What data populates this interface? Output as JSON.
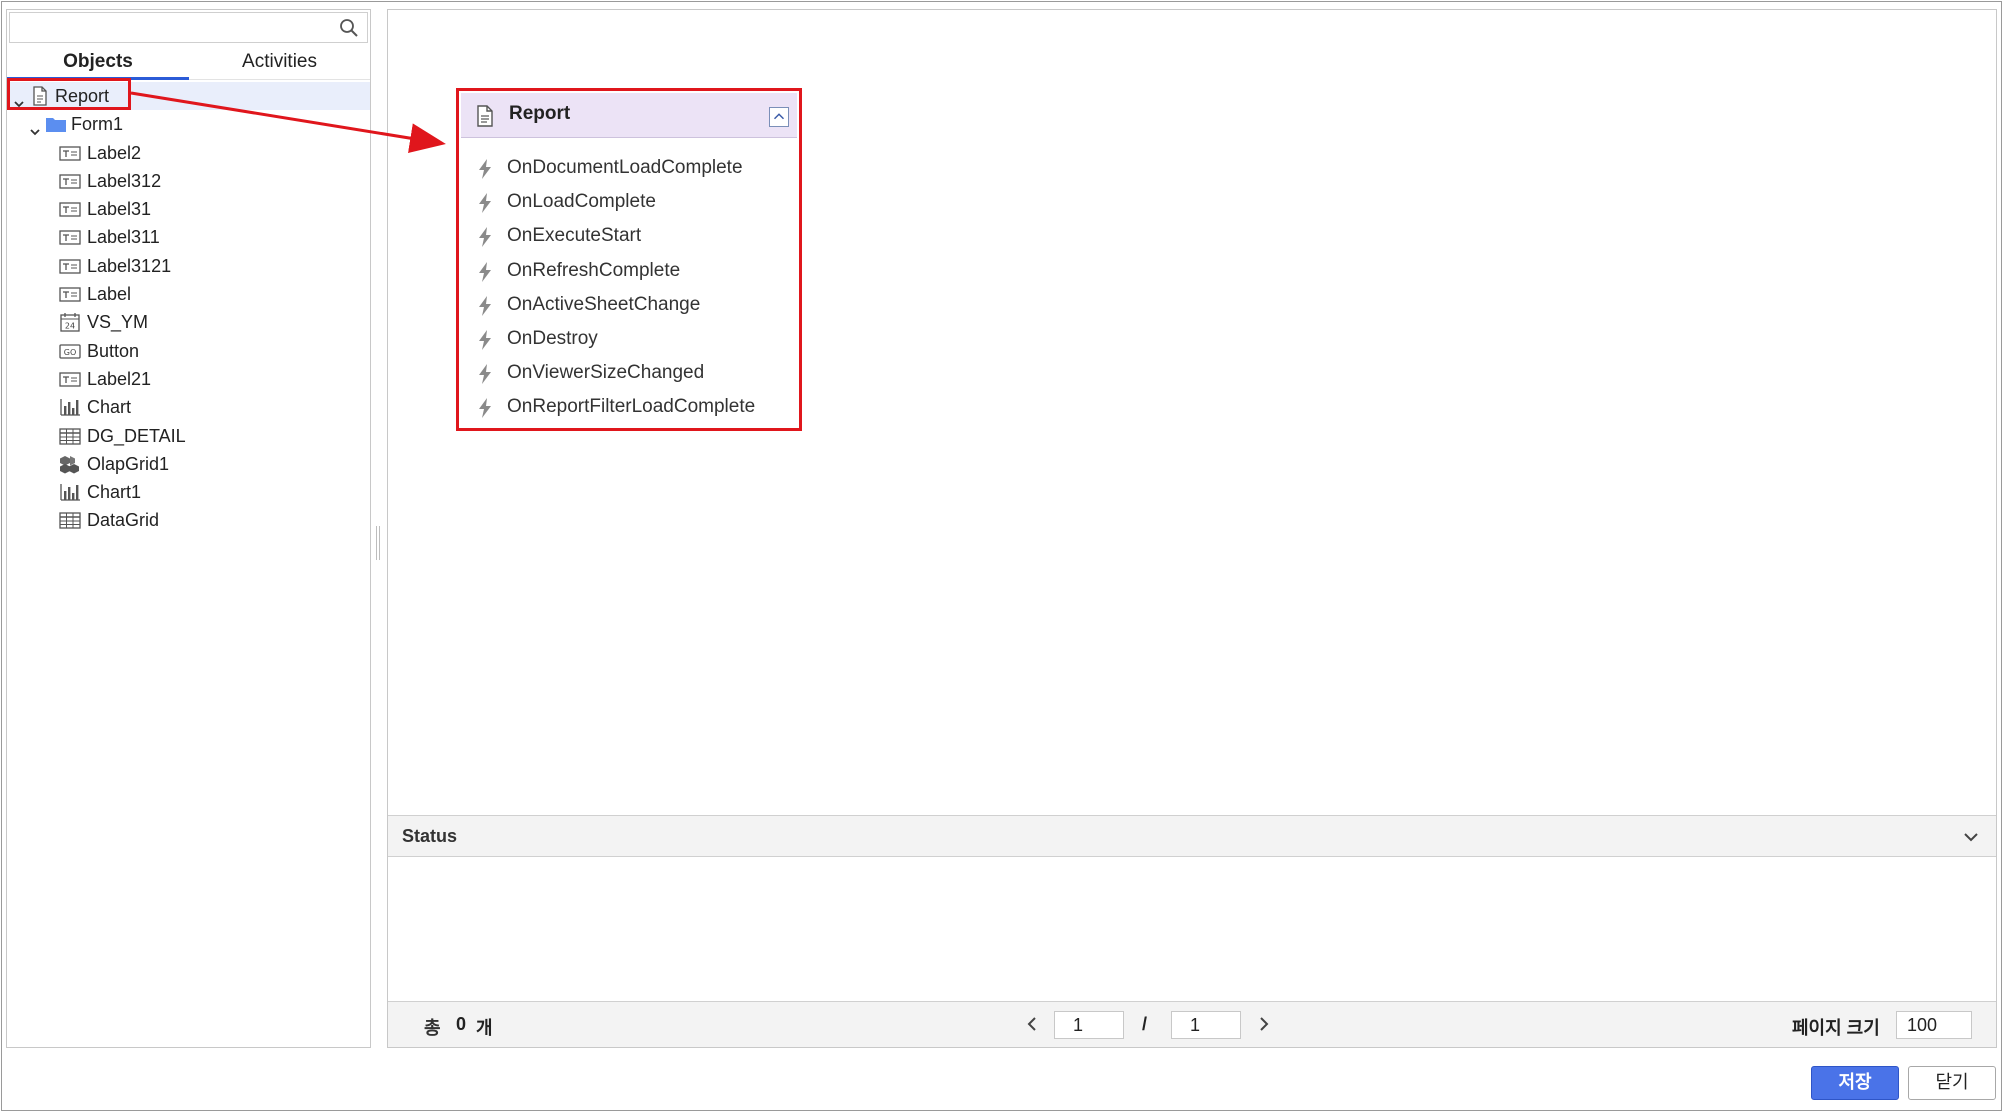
{
  "search": {
    "placeholder": ""
  },
  "tabs": [
    {
      "label": "Objects",
      "active": true
    },
    {
      "label": "Activities",
      "active": false
    }
  ],
  "tree": [
    {
      "label": "Report",
      "icon": "document-icon",
      "level": 0,
      "expanded": true,
      "selected": true
    },
    {
      "label": "Form1",
      "icon": "folder-icon",
      "level": 1,
      "expanded": true
    },
    {
      "label": "Label2",
      "icon": "label-icon",
      "level": 2
    },
    {
      "label": "Label312",
      "icon": "label-icon",
      "level": 2
    },
    {
      "label": "Label31",
      "icon": "label-icon",
      "level": 2
    },
    {
      "label": "Label311",
      "icon": "label-icon",
      "level": 2
    },
    {
      "label": "Label3121",
      "icon": "label-icon",
      "level": 2
    },
    {
      "label": "Label",
      "icon": "label-icon",
      "level": 2
    },
    {
      "label": "VS_YM",
      "icon": "calendar-icon",
      "level": 2
    },
    {
      "label": "Button",
      "icon": "button-icon",
      "level": 2
    },
    {
      "label": "Label21",
      "icon": "label-icon",
      "level": 2
    },
    {
      "label": "Chart",
      "icon": "chart-icon",
      "level": 2
    },
    {
      "label": "DG_DETAIL",
      "icon": "grid-icon",
      "level": 2
    },
    {
      "label": "OlapGrid1",
      "icon": "olap-icon",
      "level": 2
    },
    {
      "label": "Chart1",
      "icon": "chart-icon",
      "level": 2
    },
    {
      "label": "DataGrid",
      "icon": "grid-icon",
      "level": 2
    }
  ],
  "event_card": {
    "title": "Report",
    "events": [
      "OnDocumentLoadComplete",
      "OnLoadComplete",
      "OnExecuteStart",
      "OnRefreshComplete",
      "OnActiveSheetChange",
      "OnDestroy",
      "OnViewerSizeChanged",
      "OnReportFilterLoadComplete"
    ]
  },
  "status": {
    "label": "Status"
  },
  "pager": {
    "total_label": "총",
    "count": "0",
    "unit": "개",
    "current_page": "1",
    "separator": "/",
    "total_pages": "1",
    "page_size_label": "페이지 크기",
    "page_size": "100"
  },
  "buttons": {
    "save": "저장",
    "close": "닫기"
  },
  "colors": {
    "accent": "#4a73e8",
    "highlight": "#e0161c",
    "card_header": "#ece3f6",
    "tab_underline": "#2b5bd7"
  }
}
